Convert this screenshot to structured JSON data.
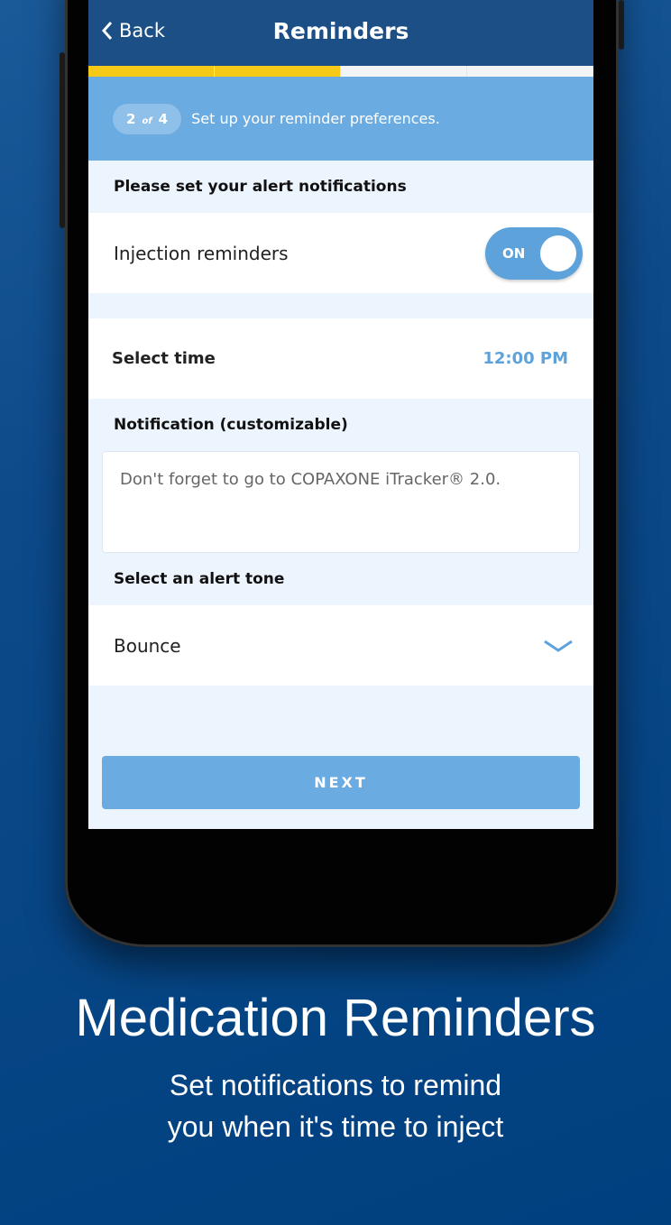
{
  "nav": {
    "back_label": "Back",
    "title": "Reminders"
  },
  "progress": {
    "current_step": 2,
    "total_steps": 4
  },
  "step": {
    "current": "2",
    "of": "of",
    "total": "4",
    "text": "Set up your reminder preferences."
  },
  "alerts": {
    "heading": "Please set your alert notifications",
    "injection_label": "Injection reminders",
    "toggle_label": "ON",
    "toggle_on": true
  },
  "time": {
    "label": "Select time",
    "value": "12:00 PM"
  },
  "notification": {
    "heading": "Notification (customizable)",
    "value": "Don't forget to go to COPAXONE iTracker® 2.0."
  },
  "tone": {
    "heading": "Select an alert tone",
    "value": "Bounce"
  },
  "next_label": "NEXT",
  "caption": {
    "title": "Medication Reminders",
    "line1": "Set notifications to remind",
    "line2": "you when it's time to inject"
  },
  "colors": {
    "nav": "#1b4f86",
    "accent": "#6aabe2",
    "progress": "#f5c918",
    "background": "#0a4683"
  }
}
